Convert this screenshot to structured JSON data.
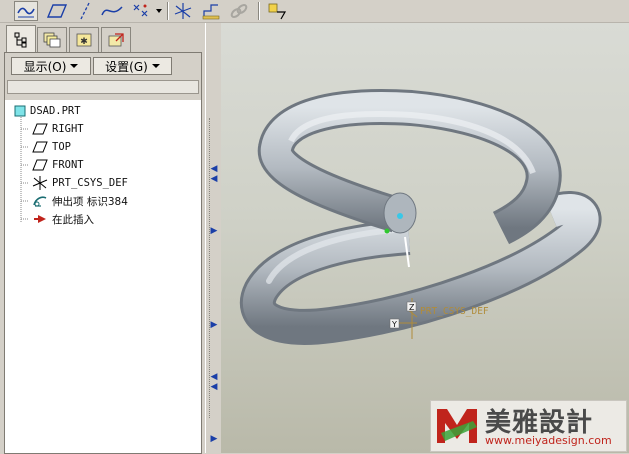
{
  "toolbar": {
    "icons": [
      "sketch-curve-icon",
      "datum-plane-icon",
      "datum-axis-icon",
      "datum-curve-icon",
      "datum-point-icon",
      "dropdown-arrow",
      "coordinate-system-icon",
      "analysis-icon",
      "link-icon",
      "insert-here-icon"
    ]
  },
  "tabs": [
    "model-tree-tab",
    "layer-tab",
    "favorites-tab",
    "navigator-tab"
  ],
  "menus": {
    "display_label": "显示(O)",
    "settings_label": "设置(G)"
  },
  "tree": {
    "root": "DSAD.PRT",
    "items": [
      {
        "icon": "plane-icon",
        "label": "RIGHT"
      },
      {
        "icon": "plane-icon",
        "label": "TOP"
      },
      {
        "icon": "plane-icon",
        "label": "FRONT"
      },
      {
        "icon": "csys-icon",
        "label": "PRT_CSYS_DEF"
      },
      {
        "icon": "sweep-icon",
        "label": "伸出项 标识384"
      },
      {
        "icon": "insert-arrow-icon",
        "label": "在此插入"
      }
    ]
  },
  "viewport": {
    "csys_label": "PRT_CSYS_DEF",
    "axis_y_label": "Y",
    "axis_z_label": "Z"
  },
  "watermark": {
    "brand_cn": "美雅設計",
    "url": "www.meiyadesign.com"
  },
  "colors": {
    "tube_light": "#c6ccd2",
    "tube_dark": "#6f7780",
    "accent_blue": "#1b3fa8",
    "watermark_red": "#c0241c"
  }
}
